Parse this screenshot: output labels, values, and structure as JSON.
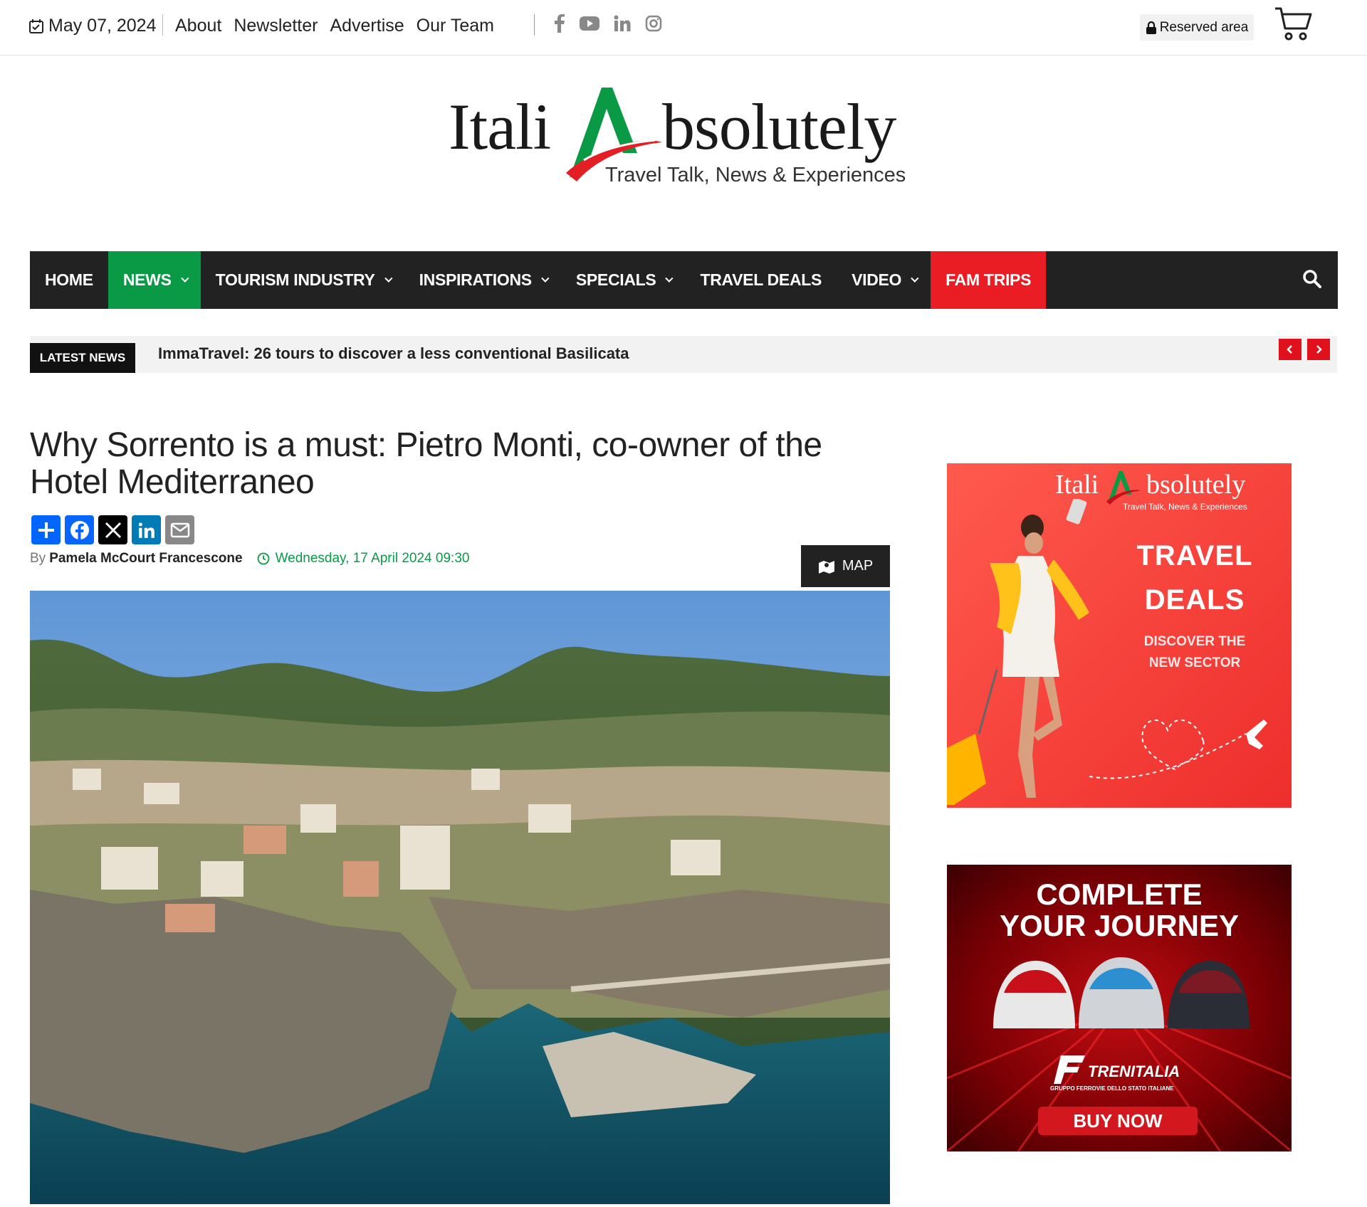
{
  "topbar": {
    "date": "May 07, 2024",
    "links": [
      "About",
      "Newsletter",
      "Advertise",
      "Our Team"
    ],
    "social_icons": [
      "facebook-icon",
      "youtube-icon",
      "linkedin-icon",
      "instagram-icon"
    ],
    "reserved_label": "Reserved area"
  },
  "logo": {
    "word1": "Itali",
    "word2": "bsolutely",
    "tagline": "Travel Talk, News & Experiences"
  },
  "nav": {
    "items": [
      {
        "label": "HOME"
      },
      {
        "label": "NEWS"
      },
      {
        "label": "TOURISM INDUSTRY"
      },
      {
        "label": "INSPIRATIONS"
      },
      {
        "label": "SPECIALS"
      },
      {
        "label": "TRAVEL DEALS"
      },
      {
        "label": "VIDEO"
      },
      {
        "label": "FAM TRIPS"
      }
    ],
    "active_color": "#0a9a46",
    "highlight_color": "#ea1c24"
  },
  "latest": {
    "badge": "LATEST NEWS",
    "headline": "ImmaTravel: 26 tours to discover a less conventional Basilicata"
  },
  "article": {
    "title": "Why Sorrento is a must: Pietro Monti, co-owner of the Hotel Mediterraneo",
    "by": "By",
    "author": "Pamela McCourt Francescone",
    "date": "Wednesday, 17 April 2024 09:30",
    "map_label": "MAP"
  },
  "ad1": {
    "logo_word1": "Itali",
    "logo_word2": "bsolutely",
    "logo_tag": "Travel Talk, News & Experiences",
    "line1": "TRAVEL",
    "line2": "DEALS",
    "sub1": "DISCOVER THE",
    "sub2": "NEW SECTOR"
  },
  "ad2": {
    "line1": "COMPLETE",
    "line2": "YOUR JOURNEY",
    "brand": "TRENITALIA",
    "brand_sub": "GRUPPO FERROVIE DELLO STATO ITALIANE",
    "cta": "BUY NOW"
  }
}
